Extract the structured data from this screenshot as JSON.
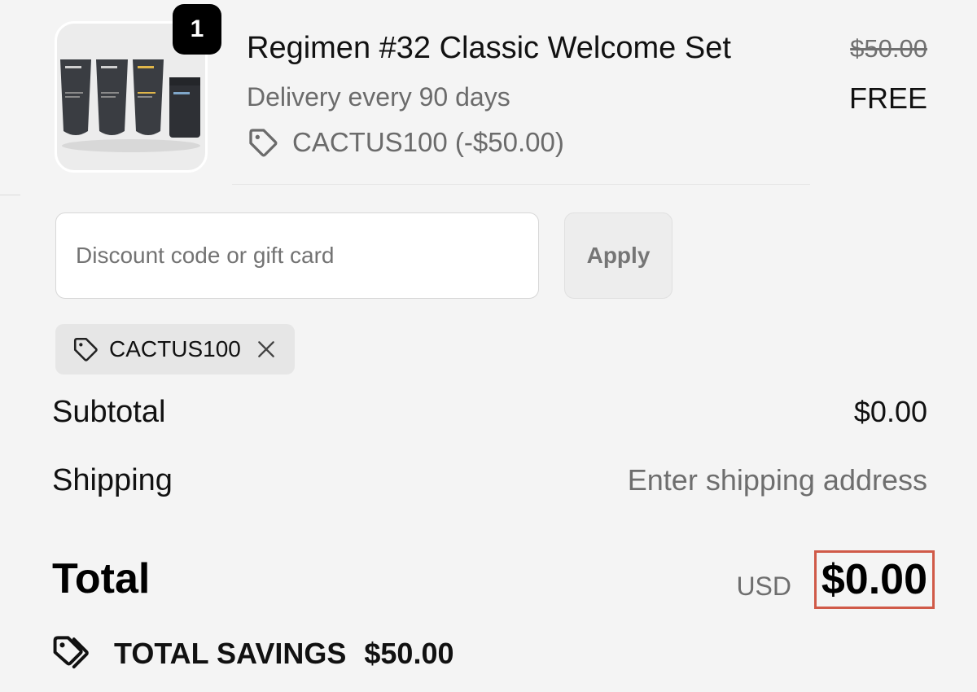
{
  "product": {
    "quantity": "1",
    "title": "Regimen #32 Classic Welcome Set",
    "delivery": "Delivery every 90 days",
    "discount_line": "CACTUS100 (-$50.00)",
    "original_price": "$50.00",
    "price": "FREE",
    "image_icon": "product-tubes-image"
  },
  "discount": {
    "placeholder": "Discount code or gift card",
    "value": "",
    "apply_label": "Apply",
    "applied_code": "CACTUS100"
  },
  "summary": {
    "subtotal_label": "Subtotal",
    "subtotal_value": "$0.00",
    "shipping_label": "Shipping",
    "shipping_value": "Enter shipping address",
    "total_label": "Total",
    "currency": "USD",
    "total_value": "$0.00",
    "savings_label": "TOTAL SAVINGS",
    "savings_value": "$50.00"
  },
  "colors": {
    "background": "#f4f4f4",
    "highlight_border": "#d05a48",
    "muted_text": "#6b6b6b"
  }
}
